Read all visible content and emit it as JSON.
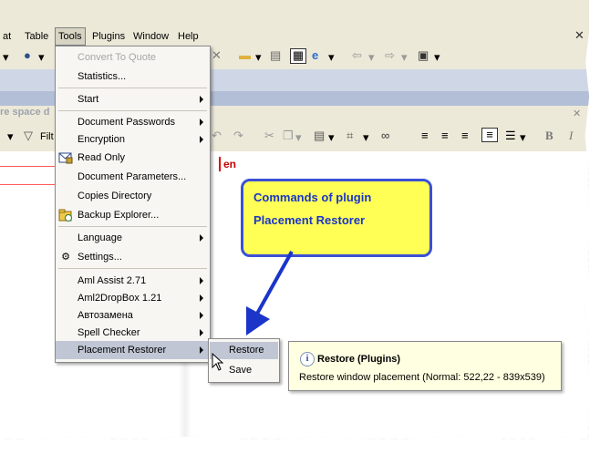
{
  "menubar": {
    "items": [
      "at",
      "Table",
      "Tools",
      "Plugins",
      "Window",
      "Help"
    ]
  },
  "tab_text": "re space d",
  "toolbar2": {
    "filter_label": "Filt",
    "bold": "B",
    "italic": "I"
  },
  "editor": {
    "lang_text": "en"
  },
  "tools_menu": {
    "items": [
      {
        "label": "Convert To Quote",
        "disabled": true
      },
      {
        "label": "Statistics..."
      },
      {
        "label": "Start"
      },
      {
        "label": "Document Passwords"
      },
      {
        "label": "Encryption"
      },
      {
        "label": "Read Only"
      },
      {
        "label": "Document Parameters..."
      },
      {
        "label": "Copies Directory"
      },
      {
        "label": "Backup Explorer..."
      },
      {
        "label": "Language"
      },
      {
        "label": "Settings..."
      },
      {
        "label": "Aml Assist 2.71"
      },
      {
        "label": "Aml2DropBox 1.21"
      },
      {
        "label": "Автозамена"
      },
      {
        "label": "Spell Checker"
      },
      {
        "label": "Placement Restorer",
        "highlighted": true
      }
    ]
  },
  "submenu": {
    "items": [
      {
        "label": "Restore",
        "highlighted": true
      },
      {
        "label": "Save"
      }
    ]
  },
  "tooltip": {
    "title": "Restore (Plugins)",
    "body": "Restore window placement (Normal: 522,22  -  839x539)"
  },
  "callout": {
    "line1": "Commands of plugin",
    "line2": "Placement Restorer"
  },
  "colors": {
    "highlight": "#c0c6d4",
    "callout_fill": "#ffff55",
    "callout_border": "#3b50d6",
    "callout_text": "#1a35c8"
  }
}
